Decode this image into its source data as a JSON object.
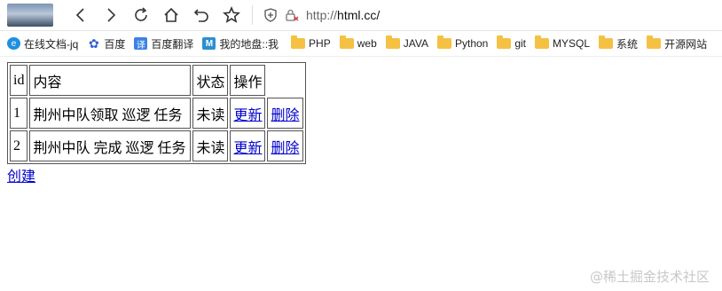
{
  "browser": {
    "url_prefix": "http://",
    "url_host": "html.cc/"
  },
  "bookmarks": [
    {
      "label": "在线文档-jq",
      "icon": "e-icon"
    },
    {
      "label": "百度",
      "icon": "baidu-paw-icon"
    },
    {
      "label": "百度翻译",
      "icon": "translate-icon"
    },
    {
      "label": "我的地盘::我",
      "icon": "m-icon"
    },
    {
      "label": "PHP",
      "icon": "folder-icon"
    },
    {
      "label": "web",
      "icon": "folder-icon"
    },
    {
      "label": "JAVA",
      "icon": "folder-icon"
    },
    {
      "label": "Python",
      "icon": "folder-icon"
    },
    {
      "label": "git",
      "icon": "folder-icon"
    },
    {
      "label": "MYSQL",
      "icon": "folder-icon"
    },
    {
      "label": "系统",
      "icon": "folder-icon"
    },
    {
      "label": "开源网站",
      "icon": "folder-icon"
    }
  ],
  "table": {
    "headers": [
      "id",
      "内容",
      "状态",
      "操作"
    ],
    "rows": [
      {
        "id": "1",
        "content": "荆州中队领取 巡逻 任务",
        "status": "未读",
        "update": "更新",
        "delete": "删除"
      },
      {
        "id": "2",
        "content": "荆州中队 完成 巡逻 任务",
        "status": "未读",
        "update": "更新",
        "delete": "删除"
      }
    ]
  },
  "create_link": "创建",
  "watermark": "@稀土掘金技术社区"
}
